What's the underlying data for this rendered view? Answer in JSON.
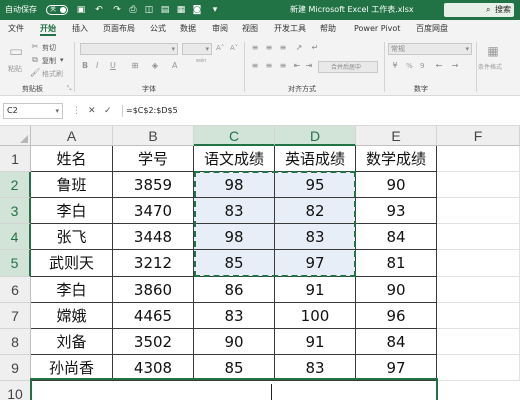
{
  "titlebar": {
    "autosave_label": "自动保存",
    "toggle_state": "关",
    "document_title": "新建 Microsoft Excel 工作表.xlsx",
    "search_label": "搜索"
  },
  "menu": {
    "tabs": [
      "文件",
      "开始",
      "插入",
      "页面布局",
      "公式",
      "数据",
      "审阅",
      "视图",
      "开发工具",
      "帮助",
      "Power Pivot",
      "百度网盘"
    ],
    "active_tab": "开始"
  },
  "ribbon": {
    "clipboard": {
      "paste": "粘贴",
      "cut": "剪切",
      "copy": "复制",
      "format_painter": "格式刷",
      "group": "剪贴板"
    },
    "font": {
      "group": "字体",
      "bold": "B",
      "italic": "I",
      "underline": "U",
      "font_a": "A",
      "wen": "wén"
    },
    "alignment": {
      "group": "对齐方式",
      "merge": "合并后居中"
    },
    "number": {
      "group": "数字",
      "format": "常规",
      "percent": "%",
      "comma": "9",
      "dec_inc": "⁰⁰",
      "dec_dec": "⁰⁰"
    },
    "styles": {
      "conditional": "条件格式"
    }
  },
  "formula_bar": {
    "cell_ref": "C2",
    "cancel": "✕",
    "enter": "✓",
    "fx": "fx",
    "formula": "=$C$2:$D$5"
  },
  "sheet": {
    "columns": [
      "A",
      "B",
      "C",
      "D",
      "E",
      "F"
    ],
    "rows": [
      "1",
      "2",
      "3",
      "4",
      "5",
      "6",
      "7",
      "8",
      "9",
      "10"
    ],
    "cells": [
      [
        "姓名",
        "学号",
        "语文成绩",
        "英语成绩",
        "数学成绩"
      ],
      [
        "鲁班",
        "3859",
        "98",
        "95",
        "90"
      ],
      [
        "李白",
        "3470",
        "83",
        "82",
        "93"
      ],
      [
        "张飞",
        "3448",
        "98",
        "83",
        "84"
      ],
      [
        "武则天",
        "3212",
        "85",
        "97",
        "81"
      ],
      [
        "李白",
        "3860",
        "86",
        "91",
        "90"
      ],
      [
        "嫦娥",
        "4465",
        "83",
        "100",
        "96"
      ],
      [
        "刘备",
        "3502",
        "90",
        "91",
        "84"
      ],
      [
        "孙尚香",
        "4308",
        "85",
        "83",
        "97"
      ]
    ]
  }
}
